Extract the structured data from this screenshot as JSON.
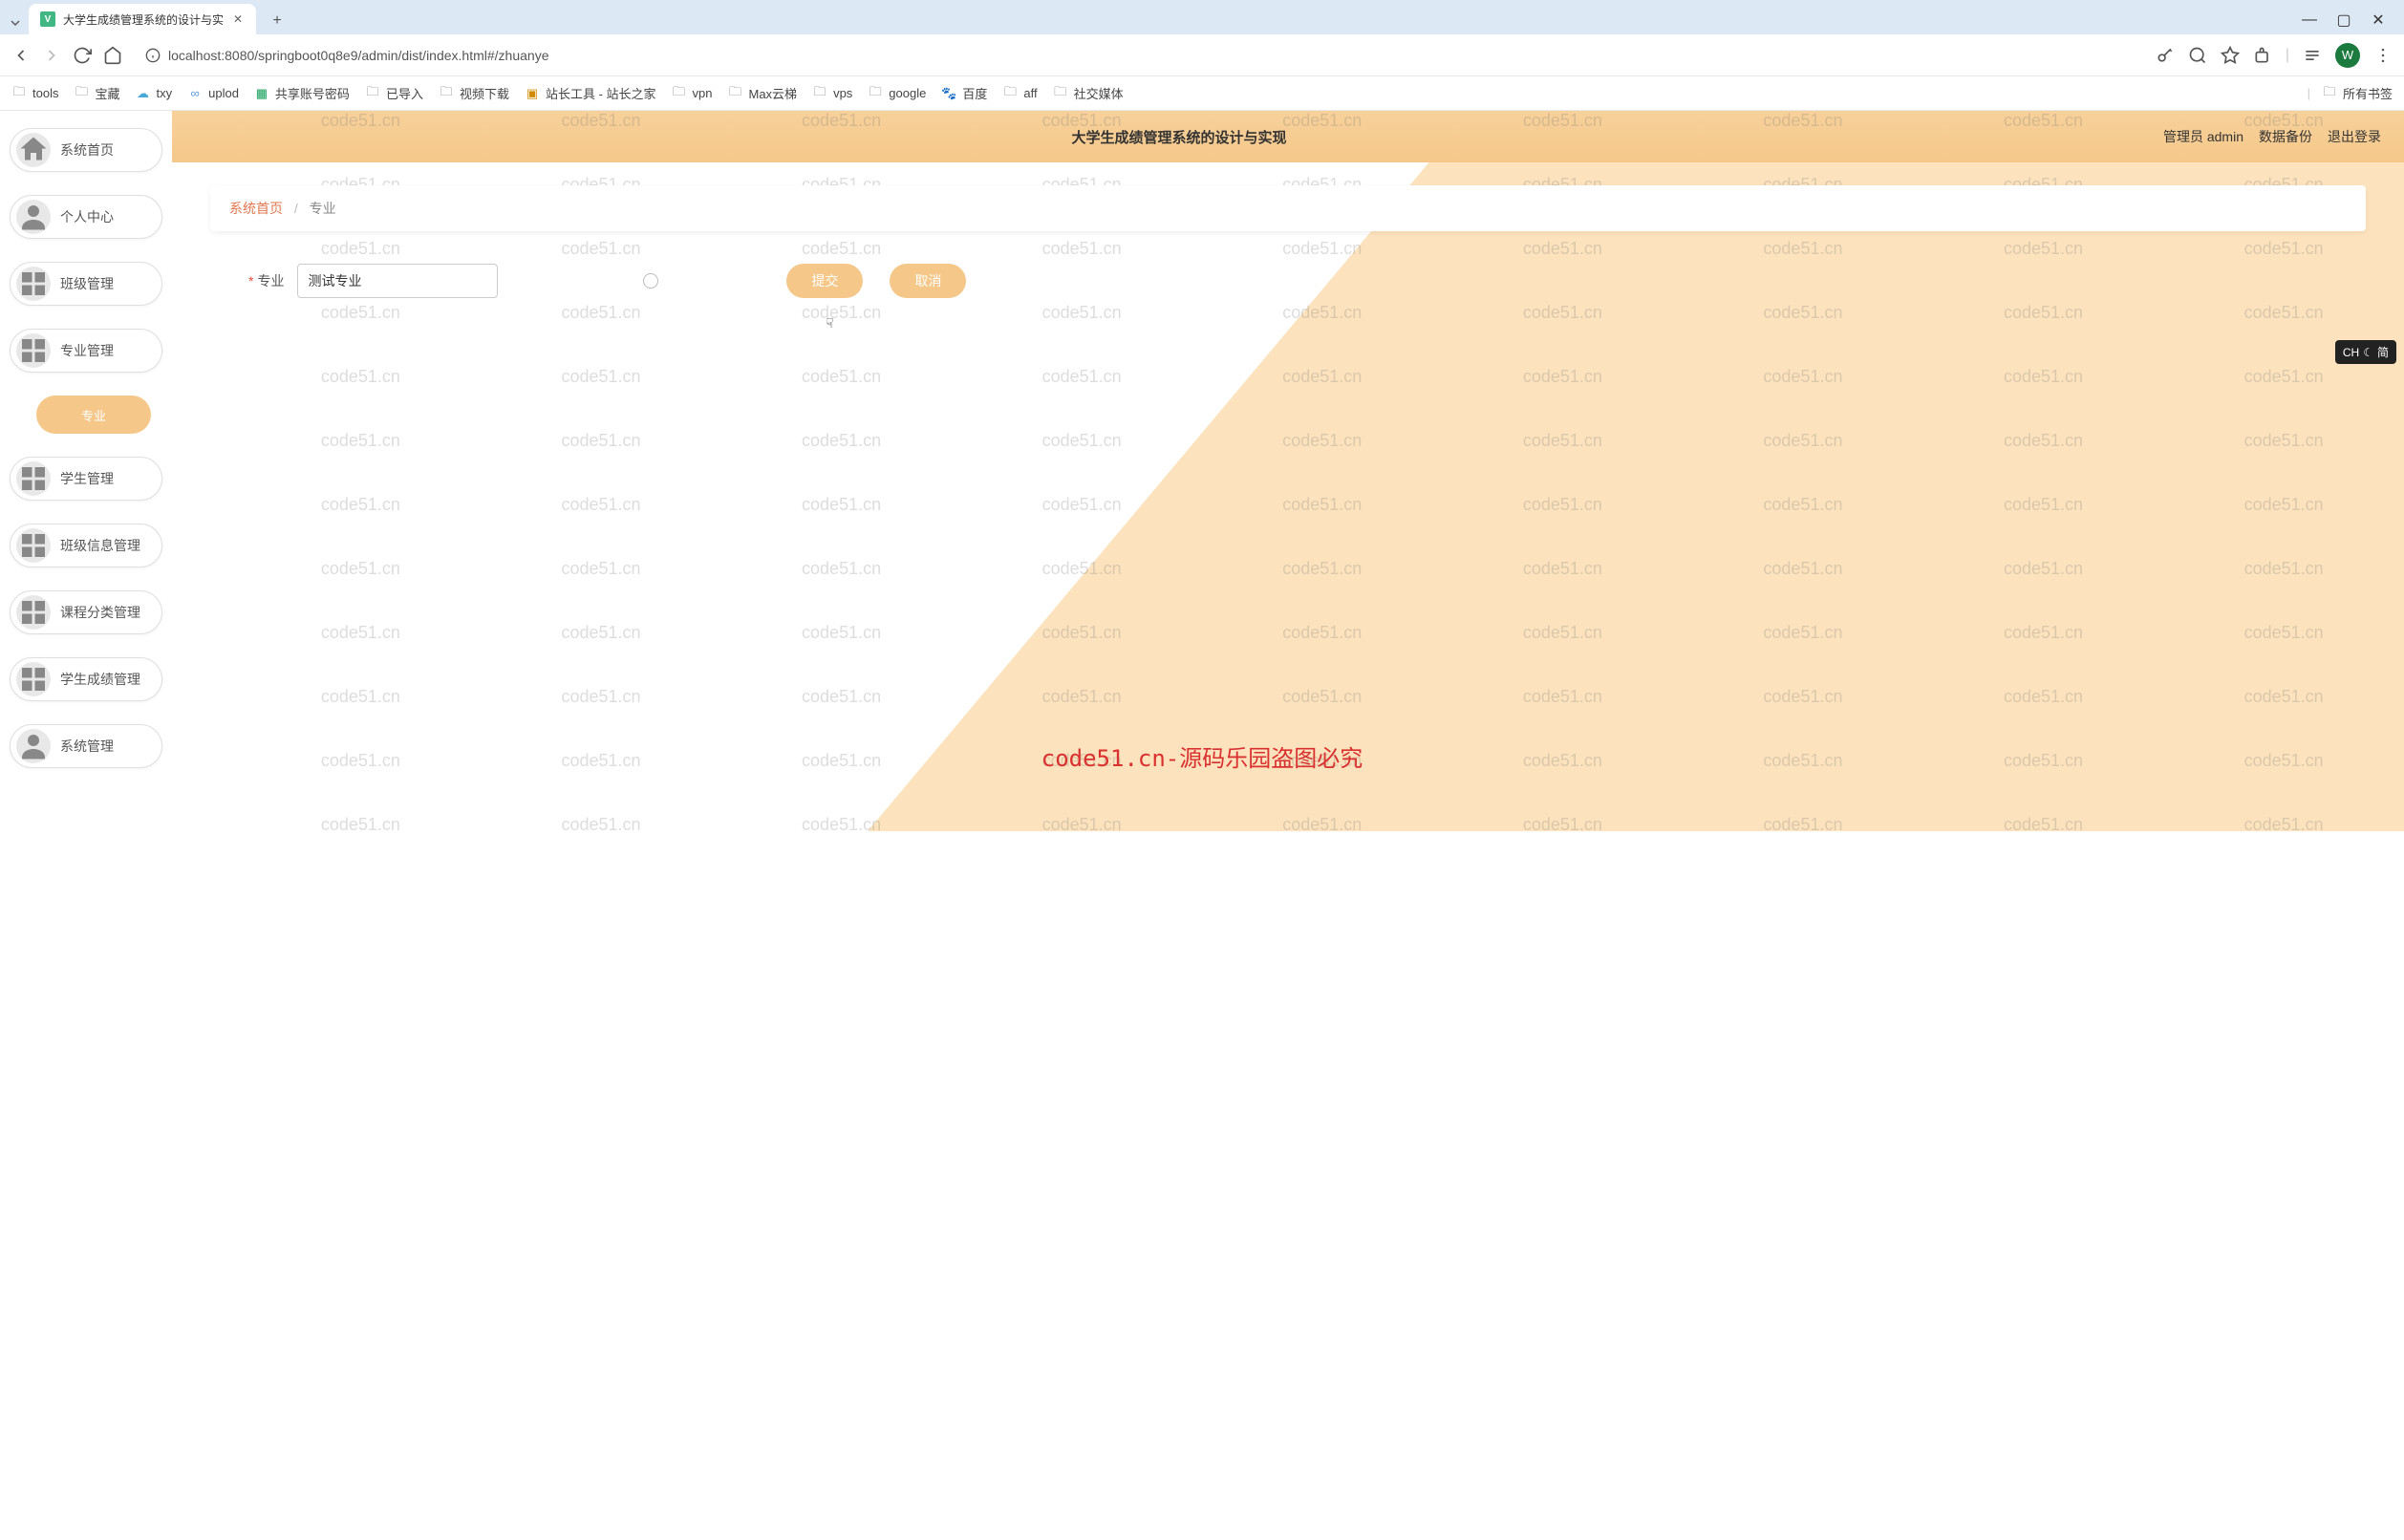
{
  "browser": {
    "tab_title": "大学生成绩管理系统的设计与实",
    "url": "localhost:8080/springboot0q8e9/admin/dist/index.html#/zhuanye",
    "profile_letter": "W"
  },
  "bookmarks": [
    "tools",
    "宝藏",
    "txy",
    "uplod",
    "共享账号密码",
    "已导入",
    "视频下载",
    "站长工具 - 站长之家",
    "vpn",
    "Max云梯",
    "vps",
    "google",
    "百度",
    "aff",
    "社交媒体"
  ],
  "bookmarks_all": "所有书签",
  "sidebar": {
    "items": [
      {
        "label": "系统首页",
        "icon": "home"
      },
      {
        "label": "个人中心",
        "icon": "user"
      },
      {
        "label": "班级管理",
        "icon": "grid"
      },
      {
        "label": "专业管理",
        "icon": "grid"
      },
      {
        "label": "学生管理",
        "icon": "grid"
      },
      {
        "label": "班级信息管理",
        "icon": "grid"
      },
      {
        "label": "课程分类管理",
        "icon": "grid"
      },
      {
        "label": "学生成绩管理",
        "icon": "grid"
      },
      {
        "label": "系统管理",
        "icon": "user"
      }
    ],
    "submenu_label": "专业"
  },
  "header": {
    "title": "大学生成绩管理系统的设计与实现",
    "user_label": "管理员 admin",
    "backup_label": "数据备份",
    "logout_label": "退出登录"
  },
  "breadcrumb": {
    "home": "系统首页",
    "current": "专业"
  },
  "form": {
    "field_label": "专业",
    "field_value": "测试专业",
    "submit_label": "提交",
    "cancel_label": "取消"
  },
  "watermark": {
    "text": "code51.cn",
    "center_text": "code51.cn-源码乐园盗图必究"
  },
  "ime": {
    "text": "CH",
    "mode": "简"
  }
}
